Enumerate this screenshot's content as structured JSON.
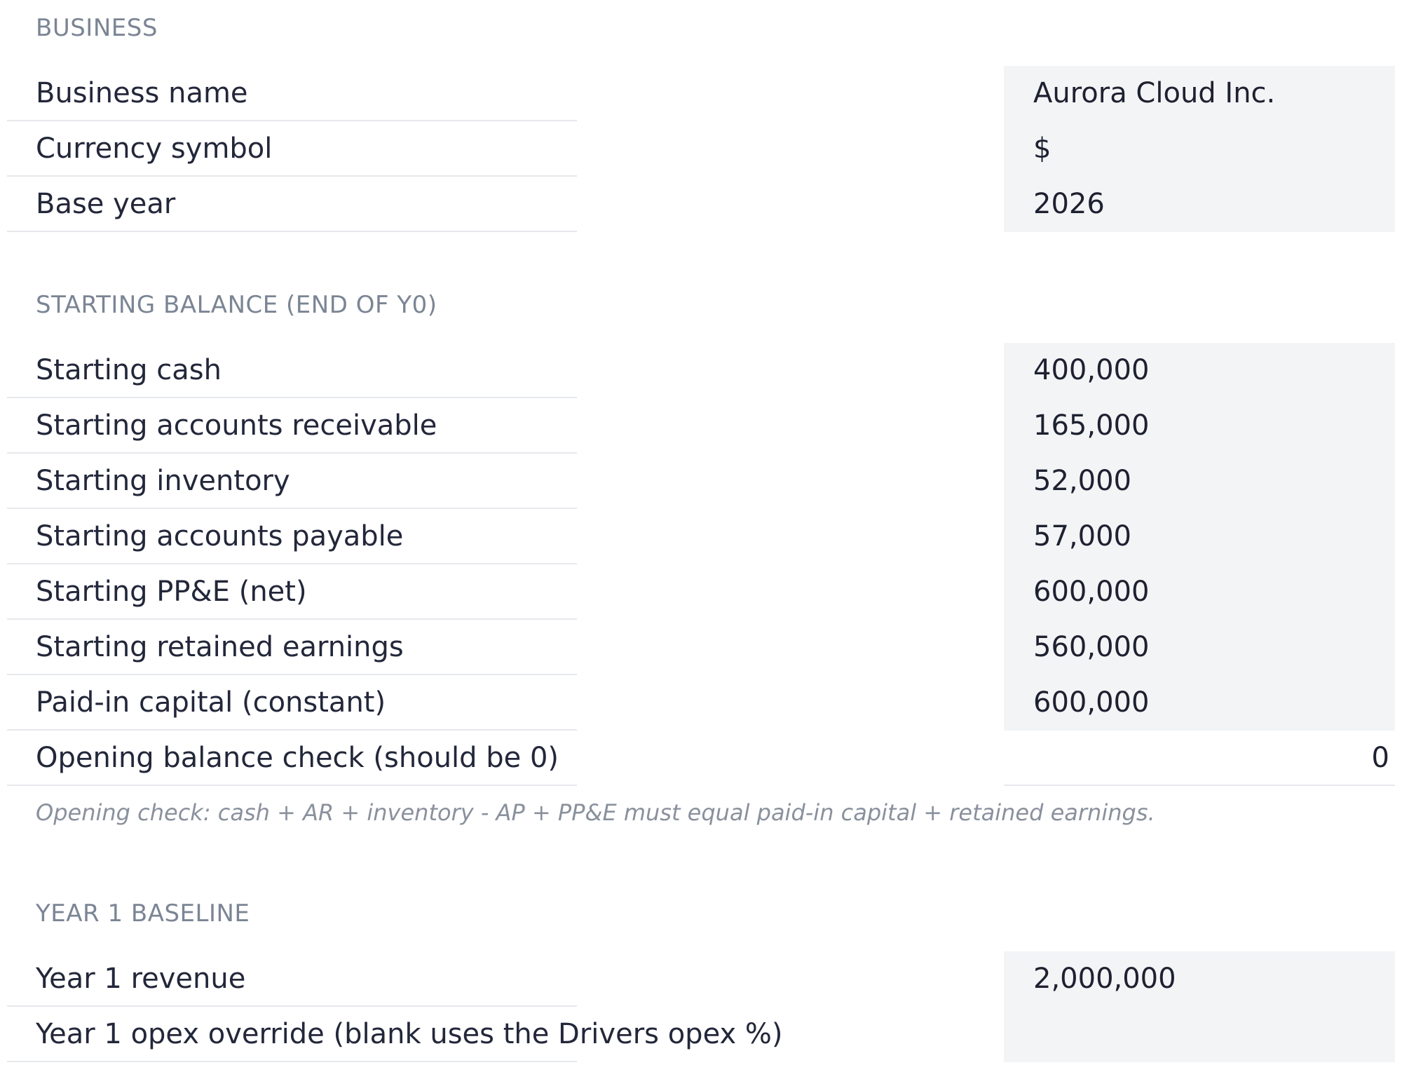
{
  "business": {
    "title": "BUSINESS",
    "fields": [
      {
        "label": "Business name",
        "value": "Aurora Cloud Inc."
      },
      {
        "label": "Currency symbol",
        "value": "$"
      },
      {
        "label": "Base year",
        "value": "2026"
      }
    ]
  },
  "starting_balance": {
    "title": "STARTING BALANCE (END OF Y0)",
    "fields": [
      {
        "label": "Starting cash",
        "value": "400,000"
      },
      {
        "label": "Starting accounts receivable",
        "value": "165,000"
      },
      {
        "label": "Starting inventory",
        "value": "52,000"
      },
      {
        "label": "Starting accounts payable",
        "value": "57,000"
      },
      {
        "label": "Starting PP&E (net)",
        "value": "600,000"
      },
      {
        "label": "Starting retained earnings",
        "value": "560,000"
      },
      {
        "label": "Paid-in capital (constant)",
        "value": "600,000"
      },
      {
        "label": "Opening balance check (should be 0)",
        "value": "0"
      }
    ],
    "note": "Opening check: cash + AR + inventory - AP + PP&E must equal paid-in capital + retained earnings."
  },
  "year1": {
    "title": "YEAR 1 BASELINE",
    "fields": [
      {
        "label": "Year 1 revenue",
        "value": "2,000,000"
      },
      {
        "label": "Year 1 opex override (blank uses the Drivers opex %)",
        "value": ""
      }
    ]
  }
}
